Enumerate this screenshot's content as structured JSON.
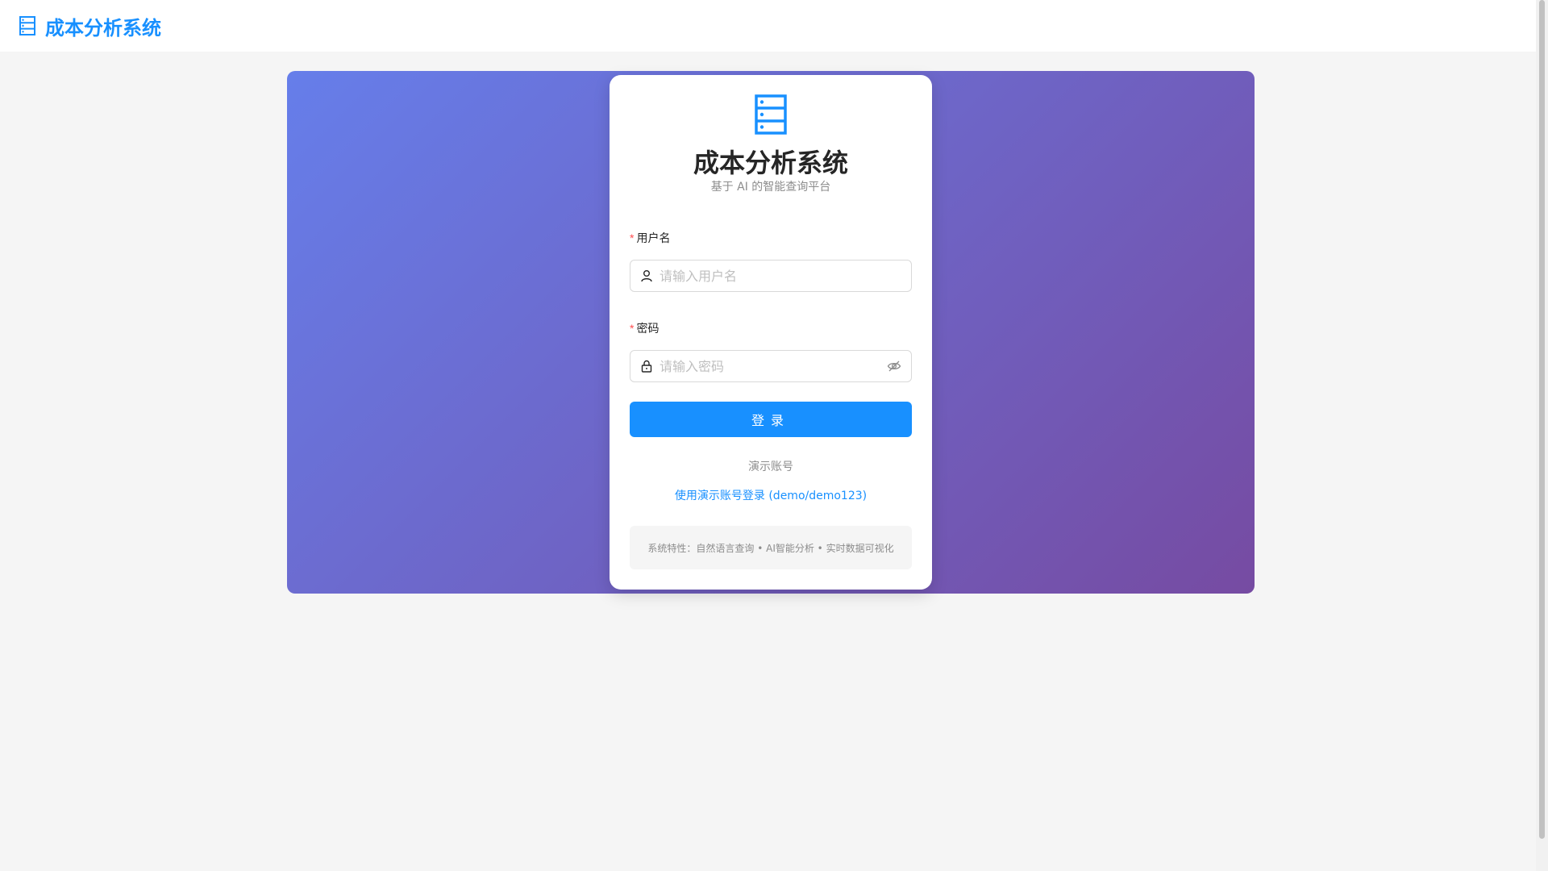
{
  "header": {
    "title": "成本分析系统",
    "icon": "database-icon"
  },
  "login": {
    "title": "成本分析系统",
    "subtitle": "基于 AI 的智能查询平台",
    "username": {
      "label": "用户名",
      "placeholder": "请输入用户名",
      "icon": "user-icon"
    },
    "password": {
      "label": "密码",
      "placeholder": "请输入密码",
      "icon": "lock-icon",
      "toggle_icon": "eye-invisible-icon"
    },
    "required_mark": "*",
    "submit_label": "登录",
    "demo": {
      "label": "演示账号",
      "link": "使用演示账号登录 (demo/demo123)"
    },
    "features": "系统特性：自然语言查询 • AI智能分析 • 实时数据可视化"
  },
  "colors": {
    "accent": "#1890ff",
    "gradient_start": "#667eea",
    "gradient_end": "#764ba2",
    "required": "#ff4d4f"
  }
}
